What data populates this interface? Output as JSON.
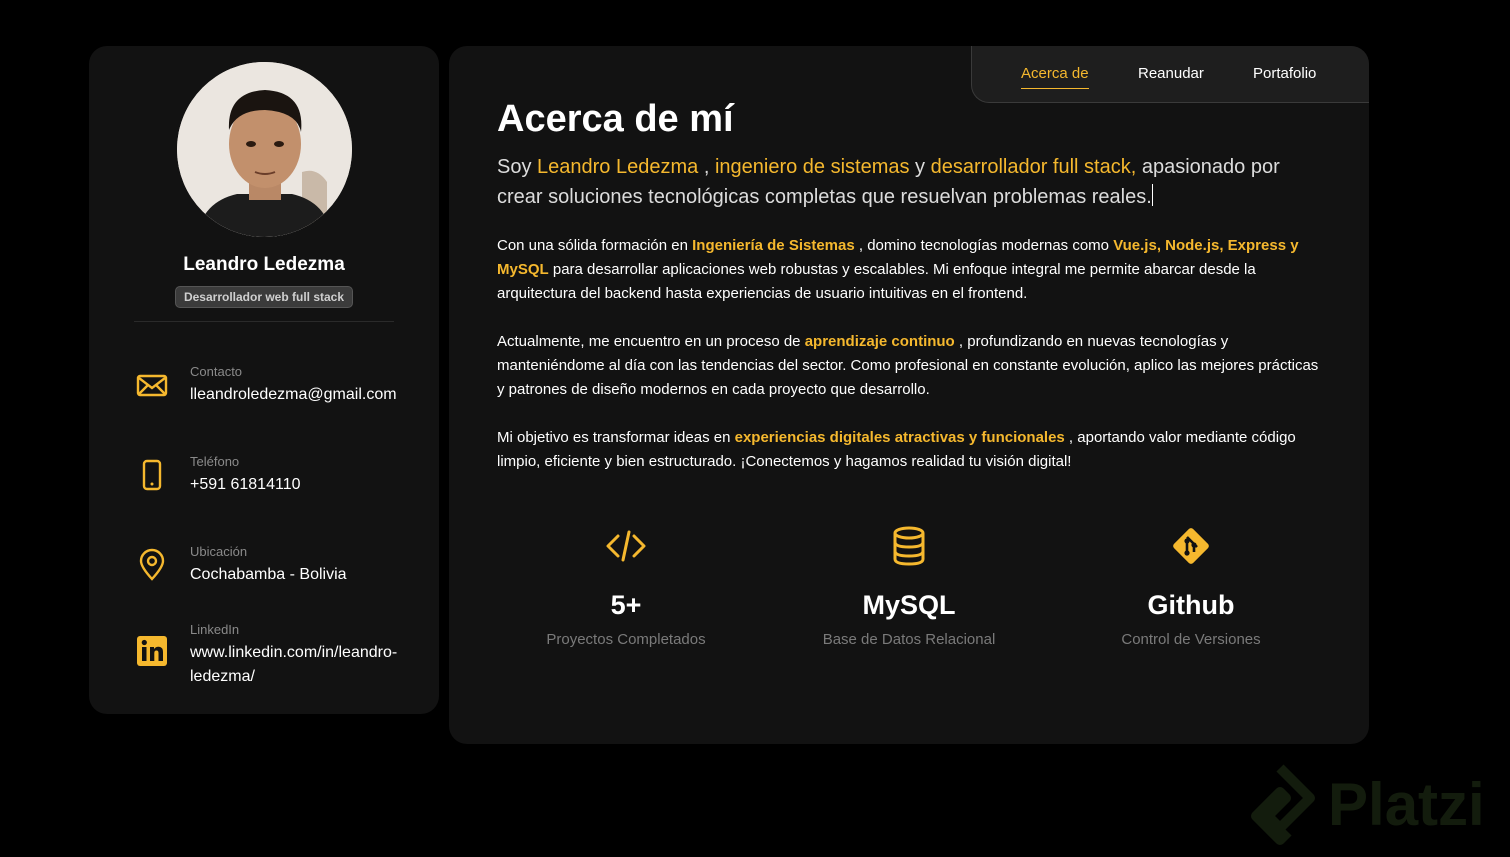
{
  "sidebar": {
    "name": "Leandro Ledezma",
    "role": "Desarrollador web full stack",
    "contacts": [
      {
        "label": "Contacto",
        "value": "lleandroledezma@gmail.com",
        "icon": "mail-icon"
      },
      {
        "label": "Teléfono",
        "value": "+591 61814110",
        "icon": "phone-icon"
      },
      {
        "label": "Ubicación",
        "value": "Cochabamba - Bolivia",
        "icon": "location-pin-icon"
      },
      {
        "label": "LinkedIn",
        "value": "www.linkedin.com/in/leandro-ledezma/",
        "icon": "linkedin-icon"
      }
    ]
  },
  "nav": {
    "items": [
      "Acerca de",
      "Reanudar",
      "Portafolio"
    ],
    "active": "Acerca de"
  },
  "about": {
    "title": "Acerca de mí",
    "intro": {
      "p1": "Soy ",
      "name": "Leandro Ledezma",
      "p2": " , ",
      "role1": "ingeniero de sistemas",
      "p3": " y ",
      "role2": "desarrollador full stack,",
      "p4": " apasionado por crear soluciones tecnológicas completas que resuelvan problemas reales."
    },
    "para1": {
      "t1": "Con una sólida formación en ",
      "h1": "Ingeniería de Sistemas",
      "t2": " , domino tecnologías modernas como ",
      "h2": "Vue.js, Node.js, Express y MySQL",
      "t3": " para desarrollar aplicaciones web robustas y escalables. Mi enfoque integral me permite abarcar desde la arquitectura del backend hasta experiencias de usuario intuitivas en el frontend."
    },
    "para2": {
      "t1": "Actualmente, me encuentro en un proceso de ",
      "h1": "aprendizaje continuo",
      "t2": " , profundizando en nuevas tecnologías y manteniéndome al día con las tendencias del sector. Como profesional en constante evolución, aplico las mejores prácticas y patrones de diseño modernos en cada proyecto que desarrollo."
    },
    "para3": {
      "t1": "Mi objetivo es transformar ideas en ",
      "h1": "experiencias digitales atractivas y funcionales",
      "t2": " , aportando valor mediante código limpio, eficiente y bien estructurado. ¡Conectemos y hagamos realidad tu visión digital!"
    }
  },
  "stats": [
    {
      "value": "5+",
      "label": "Proyectos Completados",
      "icon": "code-icon"
    },
    {
      "value": "MySQL",
      "label": "Base de Datos Relacional",
      "icon": "database-icon"
    },
    {
      "value": "Github",
      "label": "Control de Versiones",
      "icon": "git-icon"
    }
  ],
  "watermark": {
    "text": "Platzi"
  },
  "colors": {
    "accent": "#f5b82e",
    "panel": "#121212",
    "background": "#000000"
  }
}
